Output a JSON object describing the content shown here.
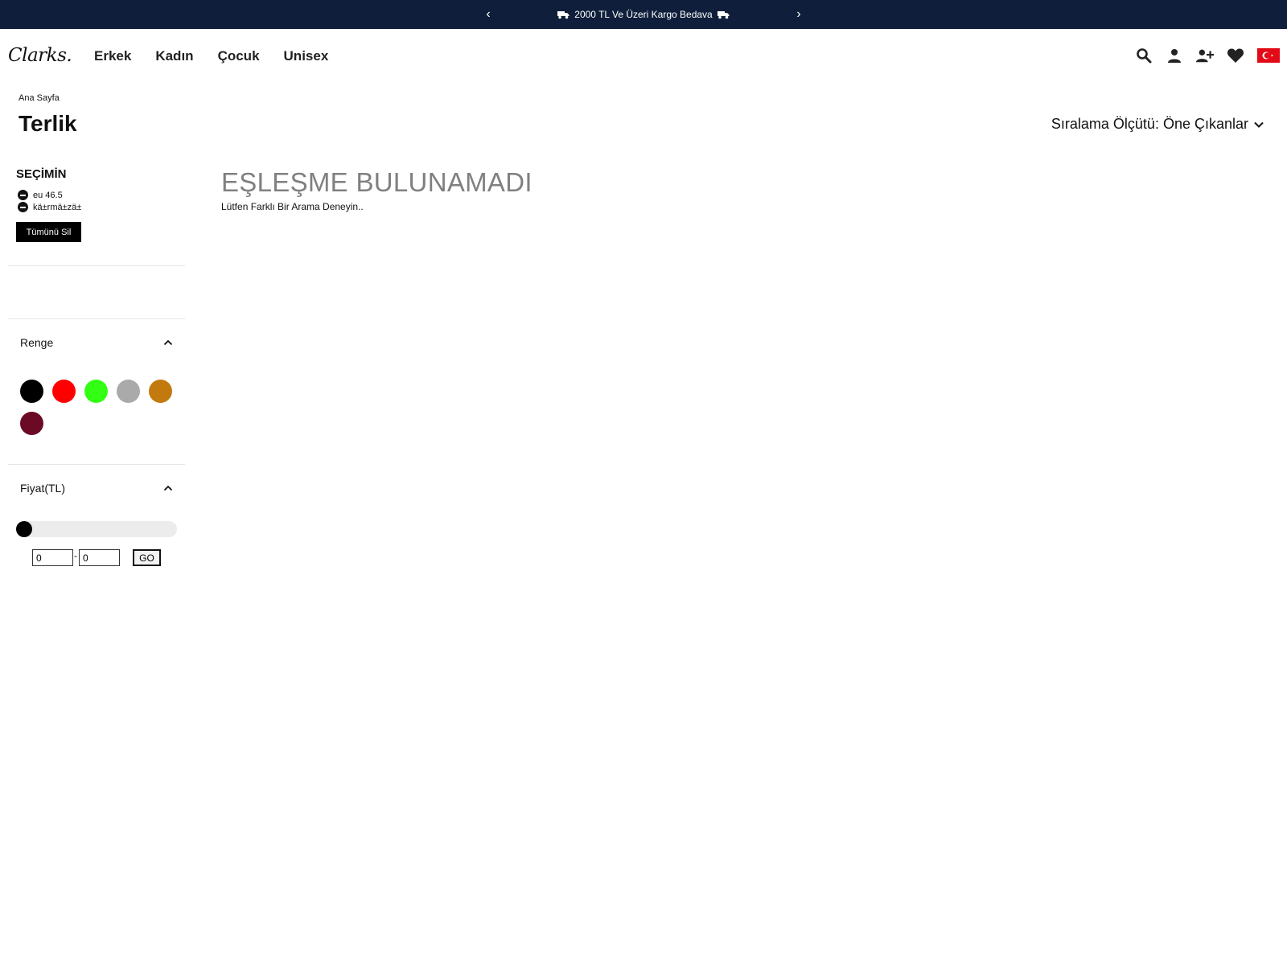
{
  "announcement": {
    "prev_label": "‹",
    "next_label": "›",
    "text": "2000 TL Ve Üzeri Kargo Bedava"
  },
  "header": {
    "logo": "Clarks.",
    "nav": [
      "Erkek",
      "Kadın",
      "Çocuk",
      "Unisex"
    ],
    "icons": [
      "search-icon",
      "account-icon",
      "register-icon",
      "wishlist-icon",
      "turkey-flag-icon"
    ]
  },
  "breadcrumb": "Ana Sayfa",
  "page_title": "Terlik",
  "selection": {
    "heading": "SEÇİMİN",
    "chips": [
      "eu 46.5",
      "kä±rmä±zä±"
    ],
    "clear_all": "Tümünü Sil"
  },
  "color_filter": {
    "heading": "Renge",
    "swatches": [
      "#000000",
      "#ff0000",
      "#33ff14",
      "#aaaaaa",
      "#c27a0e",
      "#6b0a25"
    ]
  },
  "price_filter": {
    "heading": "Fiyat(TL)",
    "min_value": "0",
    "max_value": "0",
    "dash": "-",
    "go_label": "GO",
    "slider_fraction": 0
  },
  "sort": {
    "label": "Sıralama Ölçütü: Öne Çıkanlar"
  },
  "no_results": {
    "title": "EŞLEŞME BULUNAMADI",
    "subtitle": "Lütfen Farklı Bir Arama Deneyin.."
  },
  "colors": {
    "announcement_bg": "#0f1f3b",
    "no_results_text": "#808080"
  }
}
